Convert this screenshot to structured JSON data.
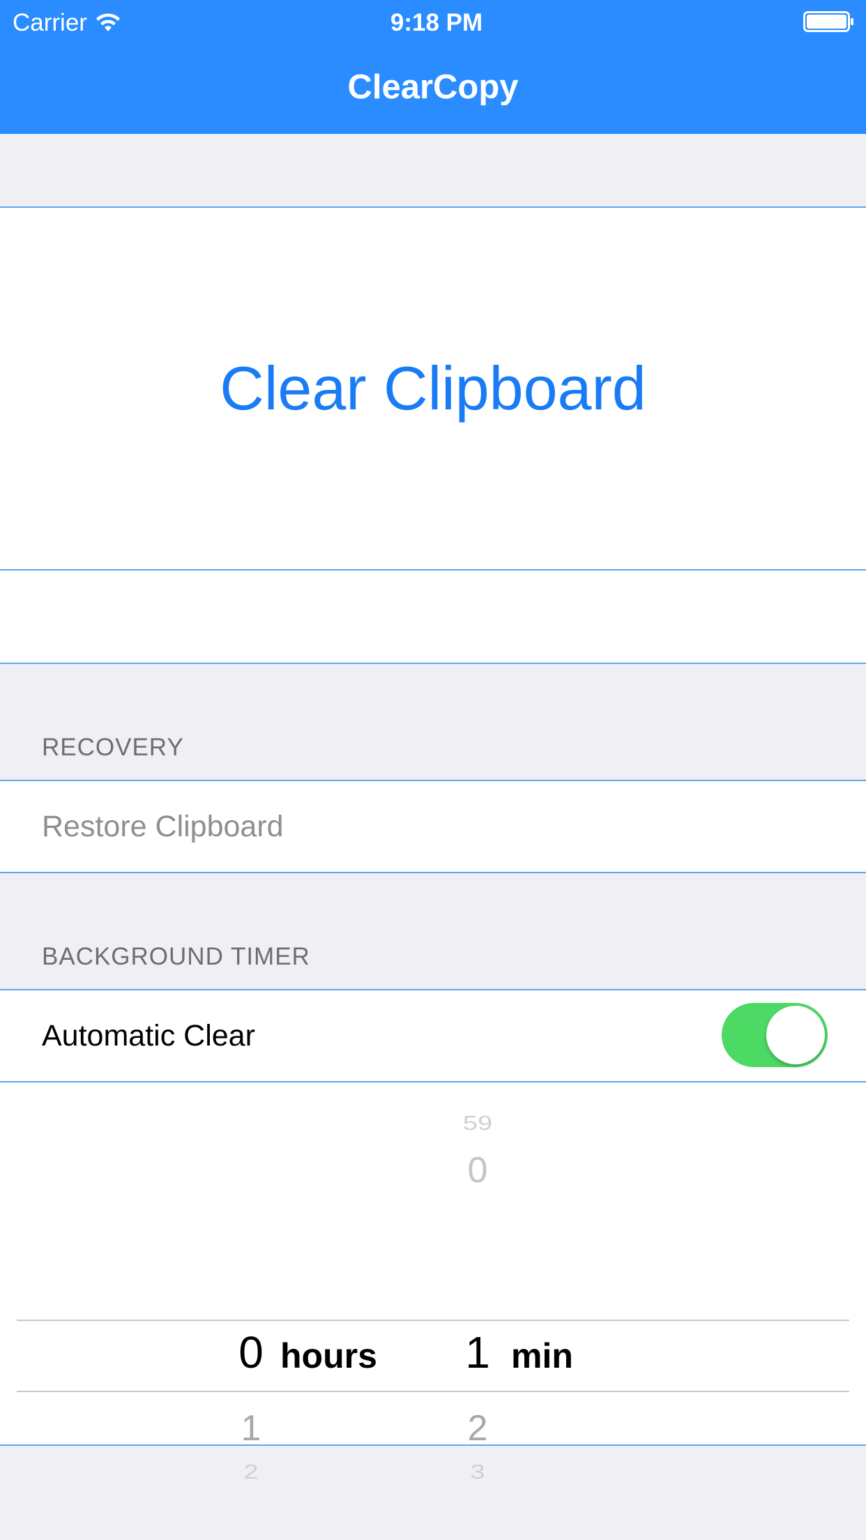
{
  "status_bar": {
    "carrier": "Carrier",
    "time": "9:18 PM",
    "wifi_icon": "wifi-icon",
    "battery_icon": "battery-icon"
  },
  "nav": {
    "title": "ClearCopy"
  },
  "main": {
    "clear_button_label": "Clear Clipboard"
  },
  "recovery": {
    "header": "RECOVERY",
    "restore_label": "Restore Clipboard"
  },
  "timer": {
    "header": "BACKGROUND TIMER",
    "auto_clear_label": "Automatic Clear",
    "auto_clear_on": true,
    "picker": {
      "hours": {
        "above": [],
        "selected": "0",
        "below": [
          "1",
          "2"
        ],
        "unit": "hours"
      },
      "minutes": {
        "above": [
          "59",
          "0"
        ],
        "selected": "1",
        "below": [
          "2",
          "3"
        ],
        "unit": "min"
      }
    }
  },
  "colors": {
    "nav_background": "#2a8cff",
    "accent": "#1a7cf5",
    "toggle_on": "#4cd964",
    "section_background": "#efeff4"
  }
}
